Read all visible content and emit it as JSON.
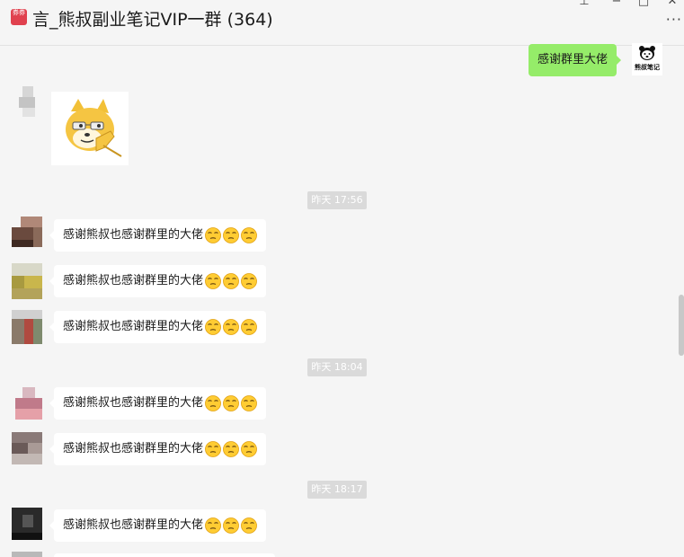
{
  "window": {
    "title": "言_熊叔副业笔记VIP一群 (364)",
    "pin_glyph": "⊥",
    "minimize_glyph": "−",
    "maximize_glyph": "□",
    "close_glyph": "✕",
    "more_glyph": "···"
  },
  "chat_icon_text": "券券",
  "self_message": {
    "text": "感谢群里大佬",
    "avatar_caption": "熊叔笔记"
  },
  "timestamps": [
    "昨天 17:56",
    "昨天 18:04",
    "昨天 18:17"
  ],
  "group_message_text": "感谢熊叔也感谢群里的大佬",
  "emoji_name": "smirk-face-emoji",
  "colors": {
    "self_bubble": "#95ec69",
    "other_bubble": "#ffffff",
    "background": "#f5f5f5",
    "timestamp_bg": "#dadada"
  }
}
